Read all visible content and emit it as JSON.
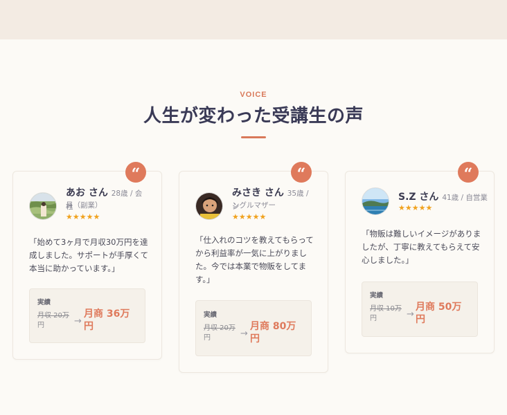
{
  "section": {
    "eyebrow": "VOICE",
    "title": "人生が変わった受講生の声"
  },
  "colors": {
    "accent": "#df7a5c",
    "star": "#f0a21e",
    "heading": "#3a3a56"
  },
  "testimonials": [
    {
      "quote_icon": "quote-icon",
      "name": "あお さん",
      "meta_line1": "28歳 / 会社",
      "meta_line2": "員（副業）",
      "rating": 5,
      "stars": "★★★★★",
      "text": [
        "「始めて3ヶ月で月収30万円を達",
        "成しました。サポートが手厚くて",
        "本当に助かっています。」"
      ],
      "result_label": "実績",
      "before_line1": "月収 20万",
      "before_line2": "円",
      "arrow": "→",
      "after_line1": "月商 36万",
      "after_line2": "円"
    },
    {
      "quote_icon": "quote-icon",
      "name": "みさき さん",
      "meta_line1": "35歳 / シ",
      "meta_line2": "ングルマザー",
      "rating": 5,
      "stars": "★★★★★",
      "text": [
        "「仕入れのコツを教えてもらって",
        "から利益率が一気に上がりまし",
        "た。今では本業で物販をしてま",
        "す。」"
      ],
      "result_label": "実績",
      "before_line1": "月収 20万",
      "before_line2": "円",
      "arrow": "→",
      "after_line1": "月商 80万",
      "after_line2": "円"
    },
    {
      "quote_icon": "quote-icon",
      "name": "S.Z さん",
      "meta_line1": "41歳 / 自営業",
      "meta_line2": "",
      "rating": 5,
      "stars": "★★★★★",
      "text": [
        "「物販は難しいイメージがありま",
        "したが、丁寧に教えてもらえて安",
        "心しました。」"
      ],
      "result_label": "実績",
      "before_line1": "月収 10万",
      "before_line2": "円",
      "arrow": "→",
      "after_line1": "月商 50万",
      "after_line2": "円"
    }
  ]
}
